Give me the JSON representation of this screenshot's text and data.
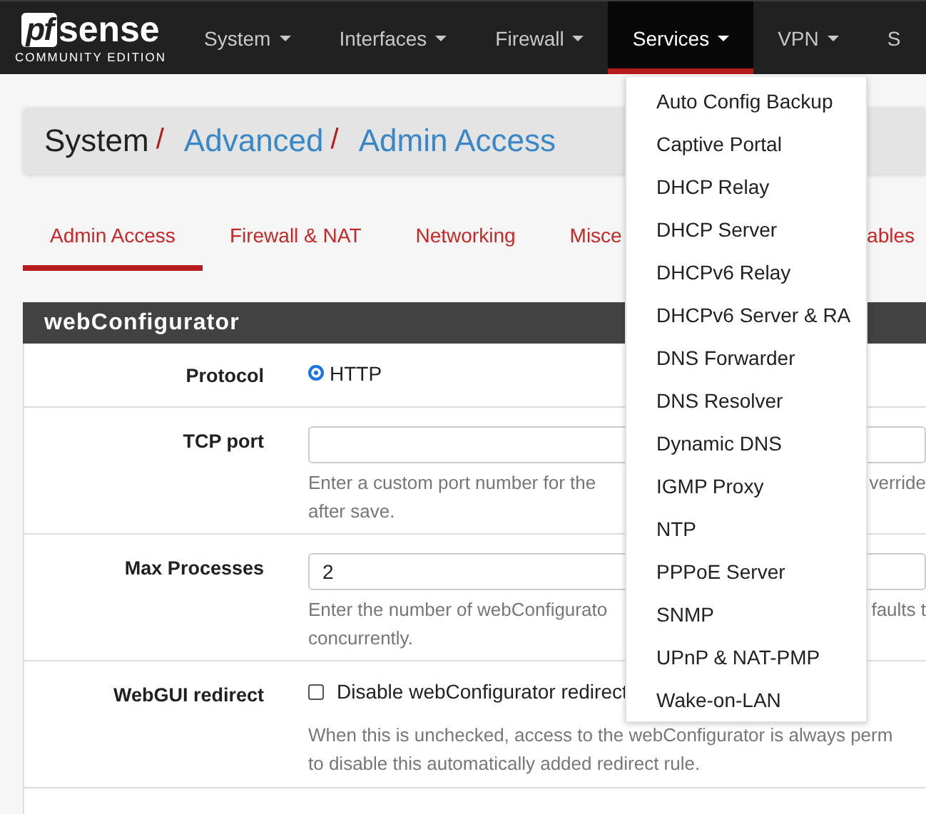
{
  "navbar": {
    "logo": {
      "mark": "pf",
      "brand": "sense",
      "edition": "COMMUNITY EDITION"
    },
    "items": [
      {
        "label": "System",
        "caret": true,
        "selected": false
      },
      {
        "label": "Interfaces",
        "caret": true,
        "selected": false
      },
      {
        "label": "Firewall",
        "caret": true,
        "selected": false
      },
      {
        "label": "Services",
        "caret": true,
        "selected": true
      },
      {
        "label": "VPN",
        "caret": true,
        "selected": false
      },
      {
        "label": "S",
        "caret": false,
        "selected": false
      }
    ]
  },
  "breadcrumb": [
    {
      "text": "System",
      "link": false,
      "separator": "/"
    },
    {
      "text": "Advanced",
      "link": true,
      "separator": "/"
    },
    {
      "text": "Admin Access",
      "link": true
    }
  ],
  "tabs": [
    {
      "label": "Admin Access",
      "selected": true
    },
    {
      "label": "Firewall & NAT",
      "selected": false
    },
    {
      "label": "Networking",
      "selected": false
    },
    {
      "label": "Misce",
      "selected": false
    },
    {
      "label": "ables",
      "selected": false
    }
  ],
  "panel": {
    "title": "webConfigurator",
    "rows": [
      {
        "kind": "radio",
        "label": "Protocol",
        "option": "HTTP",
        "selected": true
      },
      {
        "kind": "input",
        "label": "TCP port",
        "help_lines": [
          {
            "left": "Enter a custom port number for the",
            "right": "verride"
          },
          {
            "left": "after save."
          }
        ]
      },
      {
        "kind": "input",
        "label": "Max Processes",
        "value": "2",
        "help_lines": [
          {
            "left": "Enter the number of webConfigurato",
            "right": "faults t"
          },
          {
            "left": "concurrently."
          }
        ]
      },
      {
        "kind": "checkbox",
        "label": "WebGUI redirect",
        "option": "Disable webConfigurator redirect",
        "checked": false,
        "help_lines": [
          {
            "left": "When this is unchecked, access to the webConfigurator is always perm"
          },
          {
            "left": "to disable this automatically added redirect rule."
          }
        ]
      }
    ]
  },
  "services_menu": [
    "Auto Config Backup",
    "Captive Portal",
    "DHCP Relay",
    "DHCP Server",
    "DHCPv6 Relay",
    "DHCPv6 Server & RA",
    "DNS Forwarder",
    "DNS Resolver",
    "Dynamic DNS",
    "IGMP Proxy",
    "NTP",
    "PPPoE Server",
    "SNMP",
    "UPnP & NAT-PMP",
    "Wake-on-LAN"
  ]
}
